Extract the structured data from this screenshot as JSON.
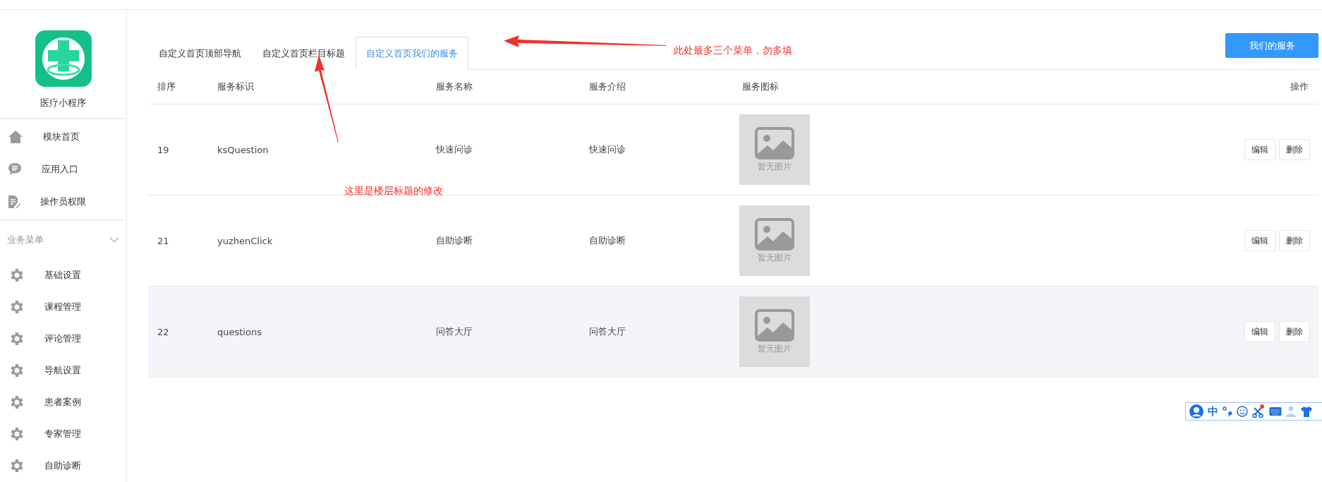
{
  "sidebar": {
    "app_name": "医疗小程序",
    "nav_items": [
      {
        "label": "模块首页",
        "kind": "home",
        "selected": false
      },
      {
        "label": "应用入口",
        "kind": "chat",
        "selected": false
      },
      {
        "label": "操作员权限",
        "kind": "doc",
        "selected": false
      }
    ],
    "section": {
      "title": "业务菜单",
      "expanded": true
    },
    "menu_items": [
      {
        "label": "基础设置",
        "selected": false
      },
      {
        "label": "课程管理",
        "selected": false
      },
      {
        "label": "评论管理",
        "selected": false
      },
      {
        "label": "导航设置",
        "selected": false
      },
      {
        "label": "患者案例",
        "selected": false
      },
      {
        "label": "专家管理",
        "selected": false
      },
      {
        "label": "自助诊断",
        "selected": false
      }
    ]
  },
  "tabs": [
    {
      "label": "自定义首页顶部导航",
      "selected": false
    },
    {
      "label": "自定义首页栏目标题",
      "selected": false
    },
    {
      "label": "自定义首页我们的服务",
      "selected": true
    }
  ],
  "primary_button": "我们的服务",
  "table": {
    "columns": [
      "排序",
      "服务标识",
      "服务名称",
      "服务介绍",
      "服务图标",
      "操作"
    ],
    "rows": [
      {
        "order": "19",
        "key": "ksQuestion",
        "name": "快速问诊",
        "intro": "快速问诊",
        "image_text": "暂无图片",
        "edit": "编辑",
        "delete": "删除",
        "highlighted": false
      },
      {
        "order": "21",
        "key": "yuzhenClick",
        "name": "自助诊断",
        "intro": "自助诊断",
        "image_text": "暂无图片",
        "edit": "编辑",
        "delete": "删除",
        "highlighted": false
      },
      {
        "order": "22",
        "key": "questions",
        "name": "问答大厅",
        "intro": "问答大厅",
        "image_text": "暂无图片",
        "edit": "编辑",
        "delete": "删除",
        "highlighted": true
      }
    ]
  },
  "annotations": [
    {
      "text": "此处最多三个菜单，勿多填",
      "kind": "left-arrow"
    },
    {
      "text": "这里是楼层标题的修改",
      "kind": "up-arrow"
    }
  ],
  "ime_toolbar": {
    "mode": "中"
  }
}
